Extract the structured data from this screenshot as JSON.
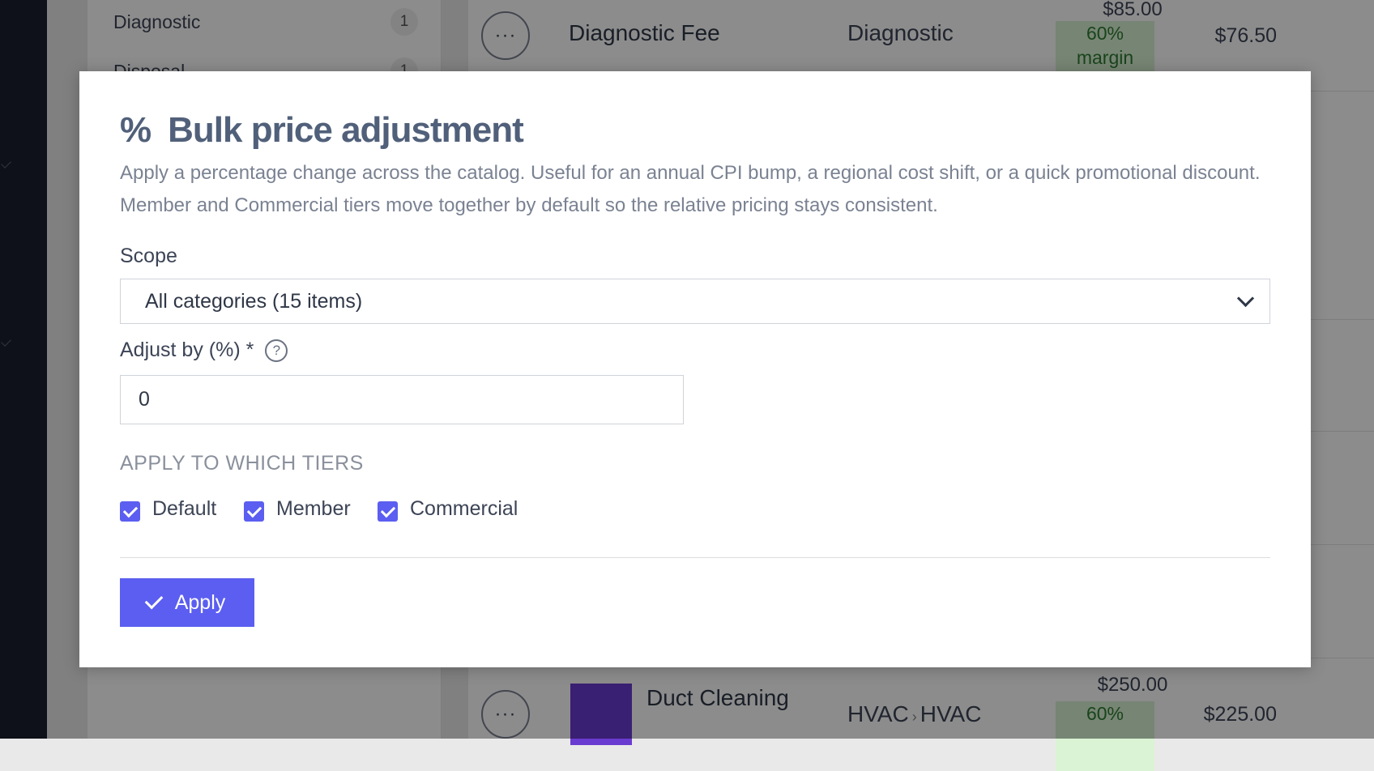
{
  "background": {
    "categories": [
      {
        "label": "Diagnostic",
        "count": "1"
      },
      {
        "label": "Disposal",
        "count": "1"
      }
    ],
    "items": [
      {
        "name": "Diagnostic Fee",
        "category": "Diagnostic",
        "price": "$85.00",
        "margin_pct": "60%",
        "margin_word": "margin",
        "member_price": "$76.50"
      },
      {
        "name": "Duct Cleaning",
        "category": "HVAC",
        "subcategory": "HVAC",
        "separator": "›",
        "price": "$250.00",
        "margin_pct": "60%",
        "member_price": "$225.00"
      }
    ],
    "more_icon": "···"
  },
  "modal": {
    "icon": "%",
    "title": "Bulk price adjustment",
    "description": "Apply a percentage change across the catalog. Useful for an annual CPI bump, a regional cost shift, or a quick promotional discount. Member and Commercial tiers move together by default so the relative pricing stays consistent.",
    "scope": {
      "label": "Scope",
      "selected": "All categories (15 items)"
    },
    "adjust": {
      "label": "Adjust by (%) *",
      "help": "?",
      "value": "0"
    },
    "tiers": {
      "heading": "APPLY TO WHICH TIERS",
      "options": [
        {
          "label": "Default",
          "checked": true
        },
        {
          "label": "Member",
          "checked": true
        },
        {
          "label": "Commercial",
          "checked": true
        }
      ]
    },
    "apply_label": "Apply",
    "accent_color": "#5b5ef0"
  }
}
